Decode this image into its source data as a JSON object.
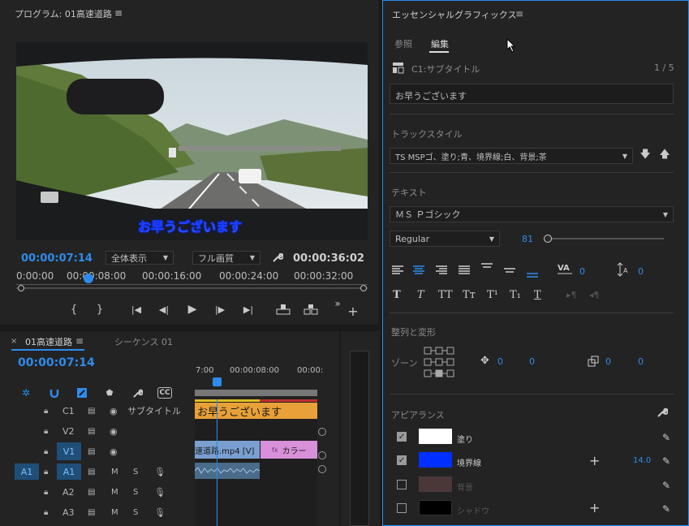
{
  "program": {
    "title": "プログラム: 01高速道路",
    "subtitle_text": "お早うございます",
    "current_tc": "00:00:07:14",
    "zoom": "全体表示",
    "quality": "フル画質",
    "duration_tc": "00:00:36:02",
    "ruler": [
      "0:00:00",
      "00:00:08:00",
      "00:00:16:00",
      "00:00:24:00",
      "00:00:32:00"
    ]
  },
  "timeline": {
    "tab_active": "01高速道路",
    "tab_other": "シーケンス 01",
    "current_tc": "00:00:07:14",
    "ruler": [
      "7:00",
      "00:00:08:00",
      "00:00:"
    ],
    "tracks": [
      {
        "target": "",
        "name": "C1",
        "label": "サブタイトル"
      },
      {
        "target": "",
        "name": "V2",
        "label": ""
      },
      {
        "target": "",
        "name": "V1",
        "label": ""
      },
      {
        "target": "A1",
        "name": "A1",
        "m": "M",
        "s": "S"
      },
      {
        "target": "",
        "name": "A2",
        "m": "M",
        "s": "S"
      },
      {
        "target": "",
        "name": "A3",
        "m": "M",
        "s": "S"
      }
    ],
    "caption_clip": "お早うございます",
    "video_clip": "速道路.mp4 [V]",
    "color_clip_fx": "fx",
    "color_clip": "カラー"
  },
  "eg": {
    "title": "エッセンシャルグラフィックス",
    "tab_browse": "参照",
    "tab_edit": "編集",
    "caption_track": "C1:サブタイトル",
    "caption_count": "1 / 5",
    "caption_text": "お早うございます",
    "track_style_label": "トラックスタイル",
    "track_style_value": "TS MSPゴ、塗り;青、境界線;白、背景;茶",
    "text_label": "テキスト",
    "font": "ＭＳ Ｐゴシック",
    "font_style": "Regular",
    "font_size": "81",
    "tracking_value": "0",
    "leading_value": "0",
    "align_section": "整列と変形",
    "zone_label": "ゾーン",
    "pos_x": "0",
    "pos_y": "0",
    "size_x": "0",
    "size_y": "0",
    "appearance_label": "アピアランス",
    "fill_label": "塗り",
    "stroke_label": "境界線",
    "stroke_width": "14.0",
    "background_label": "背景",
    "shadow_label": "シャドウ",
    "fill_color": "#ffffff",
    "stroke_color": "#0030ff",
    "bg_color": "#4a3838",
    "shadow_color": "#000000",
    "text_style_buttons": [
      "T",
      "T",
      "TT",
      "Tт",
      "T¹",
      "T₁",
      "T"
    ]
  }
}
